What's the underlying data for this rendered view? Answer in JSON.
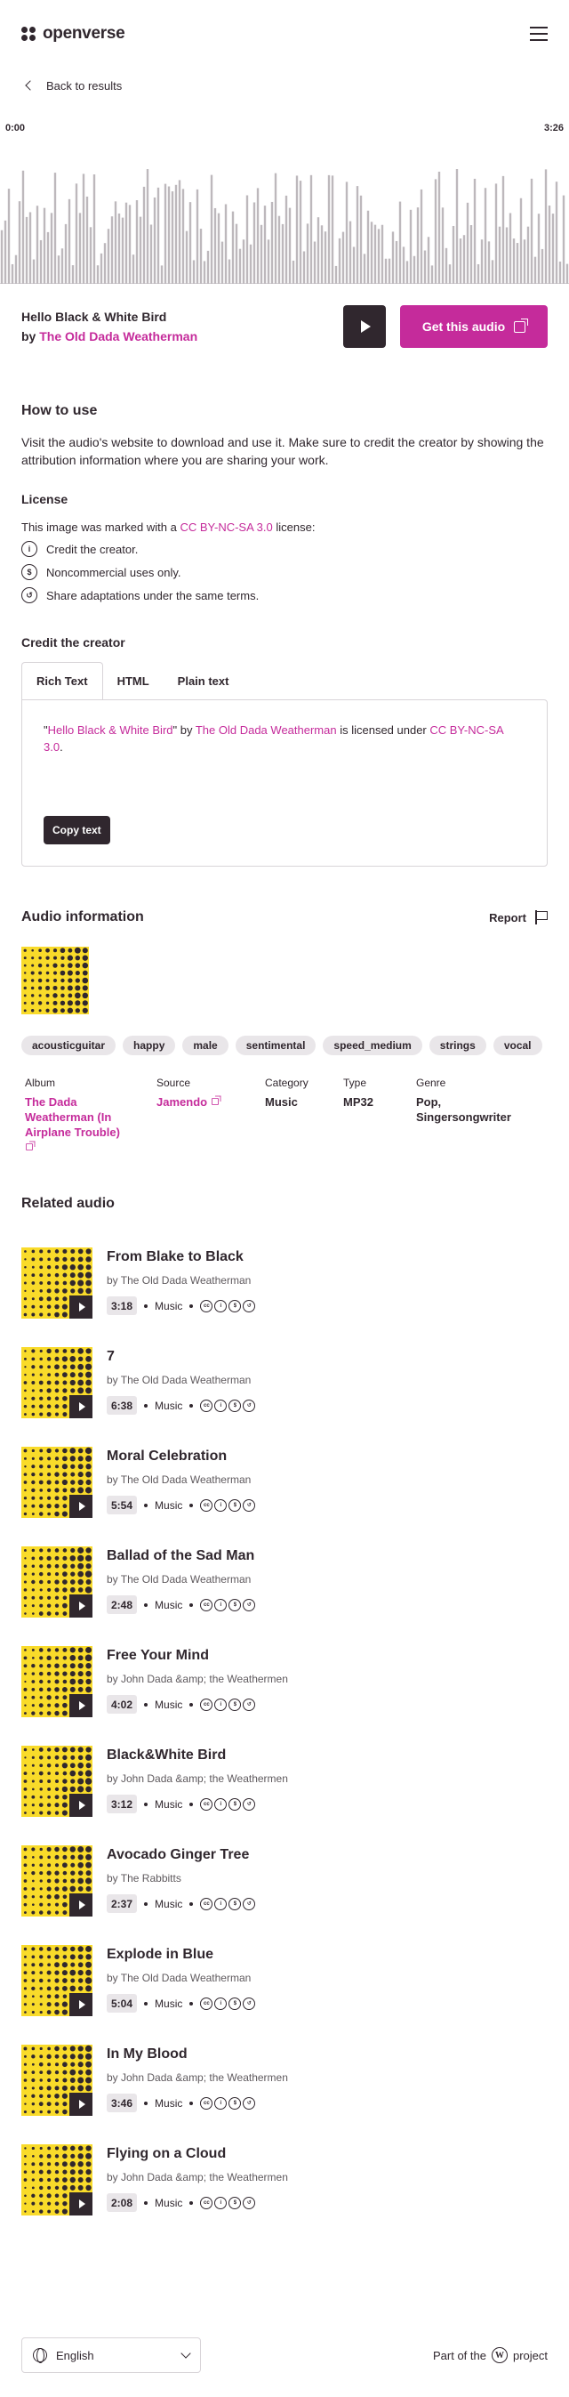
{
  "header": {
    "logo_text": "openverse",
    "menu_icon": "hamburger-icon"
  },
  "nav": {
    "back_label": "Back to results"
  },
  "player": {
    "time_start": "0:00",
    "time_end": "3:26",
    "title": "Hello Black & White Bird",
    "by_prefix": "by",
    "creator": "The Old Dada Weatherman",
    "get_label": "Get this audio"
  },
  "how_to_use": {
    "heading": "How to use",
    "body": "Visit the audio's website to download and use it. Make sure to credit the creator by showing the attribution information where you are sharing your work."
  },
  "license": {
    "heading": "License",
    "intro_before": "This image was marked with a ",
    "license_name": "CC BY-NC-SA 3.0",
    "intro_after": " license:",
    "items": [
      {
        "icon": "cc-by-icon",
        "glyph": "i",
        "text": "Credit the creator."
      },
      {
        "icon": "cc-nc-icon",
        "glyph": "$",
        "text": "Noncommercial uses only."
      },
      {
        "icon": "cc-sa-icon",
        "glyph": "↺",
        "text": "Share adaptations under the same terms."
      }
    ]
  },
  "credit": {
    "heading": "Credit the creator",
    "tabs": [
      "Rich Text",
      "HTML",
      "Plain text"
    ],
    "active_tab": 0,
    "attr_q_open": "\"",
    "attr_title": "Hello Black & White Bird",
    "attr_q_close": "\"",
    "attr_by": " by ",
    "attr_creator": "The Old Dada Weatherman",
    "attr_licensed": " is licensed under ",
    "attr_license": "CC BY-NC-SA 3.0",
    "attr_end": ".",
    "copy_label": "Copy text"
  },
  "audio_info": {
    "heading": "Audio information",
    "report_label": "Report",
    "tags": [
      "acousticguitar",
      "happy",
      "male",
      "sentimental",
      "speed_medium",
      "strings",
      "vocal"
    ],
    "meta": {
      "album_label": "Album",
      "album_value": "The Dada Weatherman (In Airplane Trouble)",
      "source_label": "Source",
      "source_value": "Jamendo",
      "category_label": "Category",
      "category_value": "Music",
      "type_label": "Type",
      "type_value": "MP32",
      "genre_label": "Genre",
      "genre_value": "Pop, Singersongwriter"
    }
  },
  "related": {
    "heading": "Related audio",
    "items": [
      {
        "title": "From Blake to Black",
        "by": "by The Old Dada Weatherman",
        "duration": "3:18",
        "category": "Music"
      },
      {
        "title": "7",
        "by": "by The Old Dada Weatherman",
        "duration": "6:38",
        "category": "Music"
      },
      {
        "title": "Moral Celebration",
        "by": "by The Old Dada Weatherman",
        "duration": "5:54",
        "category": "Music"
      },
      {
        "title": "Ballad of the Sad Man",
        "by": "by The Old Dada Weatherman",
        "duration": "2:48",
        "category": "Music"
      },
      {
        "title": "Free Your Mind",
        "by": "by John Dada &amp; the Weathermen",
        "duration": "4:02",
        "category": "Music"
      },
      {
        "title": "Black&White Bird",
        "by": "by John Dada &amp; the Weathermen",
        "duration": "3:12",
        "category": "Music"
      },
      {
        "title": "Avocado Ginger Tree",
        "by": "by The Rabbitts",
        "duration": "2:37",
        "category": "Music"
      },
      {
        "title": "Explode in Blue",
        "by": "by The Old Dada Weatherman",
        "duration": "5:04",
        "category": "Music"
      },
      {
        "title": "In My Blood",
        "by": "by John Dada &amp; the Weathermen",
        "duration": "3:46",
        "category": "Music"
      },
      {
        "title": "Flying on a Cloud",
        "by": "by John Dada &amp; the Weathermen",
        "duration": "2:08",
        "category": "Music"
      }
    ]
  },
  "footer": {
    "language": "English",
    "part_of_before": "Part of the",
    "part_of_after": "project"
  },
  "colors": {
    "accent": "#c52b9b",
    "dark": "#30272e",
    "art_yellow": "#f9db2a",
    "tag_bg": "#e9e6e9"
  }
}
